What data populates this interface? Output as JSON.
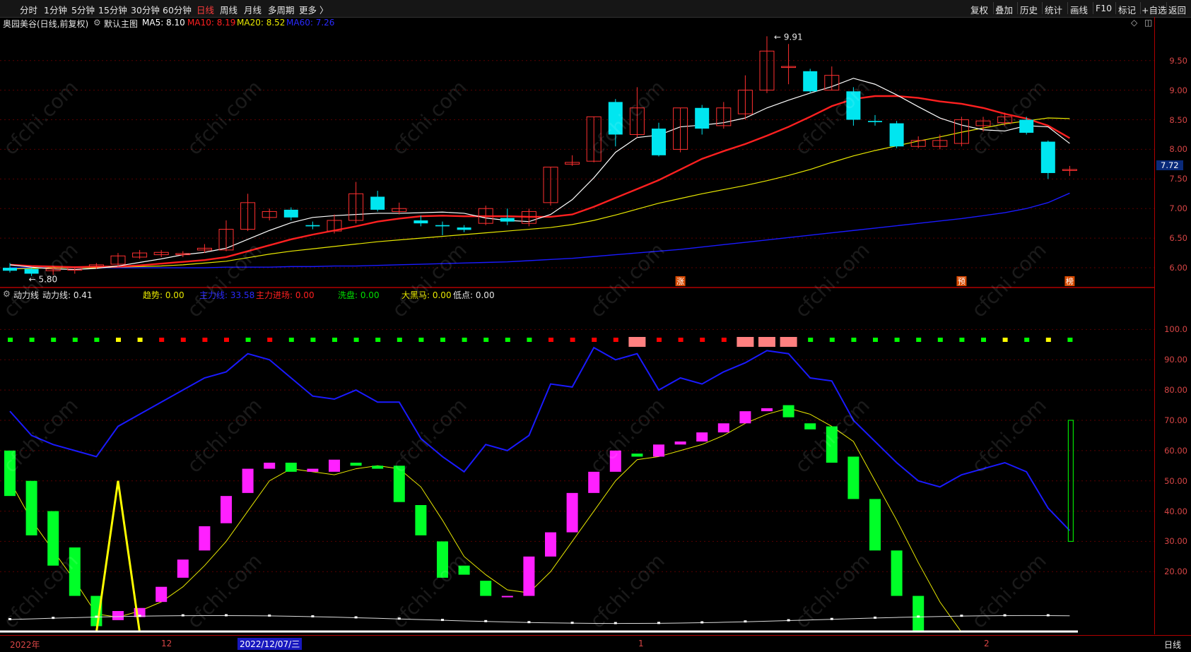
{
  "toolbar": {
    "periods": [
      "分时",
      "1分钟",
      "5分钟",
      "15分钟",
      "30分钟",
      "60分钟",
      "日线",
      "周线",
      "月线",
      "多周期",
      "更多 〉"
    ],
    "active": "日线",
    "right": [
      "复权",
      "叠加",
      "历史",
      "统计",
      "画线",
      "F10",
      "标记",
      "+自选",
      "返回"
    ]
  },
  "main_legend": {
    "title": "奥园美谷(日线,前复权)",
    "template": "默认主图",
    "ma5": "MA5: 8.10",
    "ma10": "MA10: 8.19",
    "ma20": "MA20: 8.52",
    "ma60": "MA60: 7.26",
    "colors": {
      "ma5": "#ffffff",
      "ma10": "#ff2020",
      "ma20": "#e8e800",
      "ma60": "#1a1aff"
    }
  },
  "sub_legend": {
    "name": "动力线",
    "power": "动力线: 0.41",
    "trend": "趋势: 0.00",
    "main_force": "主力线: 33.58",
    "inflow": "主力进场: 0.00",
    "wash": "洗盘: 0.00",
    "horse": "大黑马: 0.00",
    "low": "低点: 0.00"
  },
  "price_axis": [
    "9.50",
    "9.00",
    "8.50",
    "8.00",
    "7.50",
    "7.00",
    "6.50",
    "6.00"
  ],
  "price_current": "7.72",
  "sub_axis": [
    "100.0",
    "90.00",
    "80.00",
    "70.00",
    "60.00",
    "50.00",
    "40.00",
    "30.00",
    "20.00"
  ],
  "dates": {
    "d1": "2022年",
    "d2": "12",
    "cursor": "2022/12/07/三",
    "d3": "1",
    "d4": "2",
    "period_label": "日线"
  },
  "annotations": {
    "high": "9.91",
    "low": "5.80",
    "m1": "涨",
    "m2": "预",
    "m3": "榜"
  },
  "watermark": "cfchi.com",
  "chart_data": [
    {
      "type": "candlestick",
      "title": "奥园美谷(日线,前复权)",
      "ylim": [
        5.75,
        9.95
      ],
      "candles": [
        [
          6.0,
          5.95,
          6.08,
          5.92
        ],
        [
          5.98,
          5.9,
          6.0,
          5.86
        ],
        [
          5.95,
          5.98,
          6.02,
          5.88
        ],
        [
          5.96,
          6.0,
          6.02,
          5.9
        ],
        [
          6.02,
          6.05,
          6.08,
          5.98
        ],
        [
          6.06,
          6.2,
          6.25,
          6.02
        ],
        [
          6.18,
          6.25,
          6.3,
          6.15
        ],
        [
          6.22,
          6.26,
          6.3,
          6.18
        ],
        [
          6.22,
          6.24,
          6.28,
          6.18
        ],
        [
          6.3,
          6.33,
          6.4,
          6.25
        ],
        [
          6.3,
          6.65,
          6.8,
          6.28
        ],
        [
          6.65,
          7.1,
          7.25,
          6.62
        ],
        [
          6.85,
          6.95,
          7.0,
          6.8
        ],
        [
          6.98,
          6.85,
          7.02,
          6.8
        ],
        [
          6.72,
          6.7,
          6.78,
          6.65
        ],
        [
          6.62,
          6.8,
          6.9,
          6.58
        ],
        [
          6.8,
          7.25,
          7.45,
          6.75
        ],
        [
          7.2,
          6.98,
          7.3,
          6.95
        ],
        [
          6.95,
          7.0,
          7.1,
          6.9
        ],
        [
          6.8,
          6.75,
          6.88,
          6.7
        ],
        [
          6.72,
          6.7,
          6.78,
          6.55
        ],
        [
          6.68,
          6.64,
          6.72,
          6.6
        ],
        [
          6.75,
          7.0,
          7.05,
          6.72
        ],
        [
          6.84,
          6.78,
          7.0,
          6.72
        ],
        [
          6.75,
          6.95,
          7.0,
          6.7
        ],
        [
          7.1,
          7.7,
          7.7,
          7.05
        ],
        [
          7.75,
          7.78,
          7.9,
          7.72
        ],
        [
          7.8,
          8.55,
          8.55,
          7.78
        ],
        [
          8.8,
          8.25,
          8.85,
          8.05
        ],
        [
          8.25,
          8.7,
          9.05,
          8.2
        ],
        [
          8.35,
          7.9,
          8.45,
          7.88
        ],
        [
          8.0,
          8.7,
          8.7,
          7.95
        ],
        [
          8.7,
          8.35,
          8.75,
          8.25
        ],
        [
          8.4,
          8.7,
          8.8,
          8.35
        ],
        [
          8.6,
          9.0,
          9.25,
          8.5
        ],
        [
          9.0,
          9.66,
          9.91,
          8.95
        ],
        [
          9.4,
          9.4,
          9.78,
          9.1
        ],
        [
          9.32,
          8.98,
          9.36,
          8.95
        ],
        [
          9.0,
          9.25,
          9.4,
          9.0
        ],
        [
          8.98,
          8.5,
          9.05,
          8.4
        ],
        [
          8.48,
          8.46,
          8.58,
          8.4
        ],
        [
          8.44,
          8.05,
          8.48,
          8.02
        ],
        [
          8.05,
          8.15,
          8.22,
          8.02
        ],
        [
          8.05,
          8.15,
          8.25,
          8.0
        ],
        [
          8.1,
          8.5,
          8.55,
          8.05
        ],
        [
          8.4,
          8.48,
          8.55,
          8.3
        ],
        [
          8.45,
          8.55,
          8.62,
          8.4
        ],
        [
          8.5,
          8.28,
          8.55,
          8.25
        ],
        [
          8.13,
          7.6,
          8.15,
          7.5
        ],
        [
          7.65,
          7.66,
          7.72,
          7.55
        ]
      ],
      "ma5": [
        6.05,
        6.01,
        5.98,
        5.97,
        5.99,
        6.03,
        6.09,
        6.15,
        6.22,
        6.26,
        6.33,
        6.48,
        6.63,
        6.76,
        6.85,
        6.88,
        6.9,
        6.92,
        6.92,
        6.93,
        6.94,
        6.92,
        6.84,
        6.8,
        6.78,
        6.9,
        7.15,
        7.52,
        7.95,
        8.2,
        8.24,
        8.38,
        8.41,
        8.45,
        8.53,
        8.7,
        8.83,
        8.95,
        9.06,
        9.2,
        9.1,
        8.92,
        8.72,
        8.53,
        8.41,
        8.33,
        8.31,
        8.4,
        8.38,
        8.1
      ],
      "ma10": [
        6.05,
        6.03,
        6.02,
        6.01,
        6.02,
        6.02,
        6.04,
        6.07,
        6.1,
        6.13,
        6.18,
        6.28,
        6.38,
        6.48,
        6.56,
        6.63,
        6.7,
        6.78,
        6.83,
        6.87,
        6.88,
        6.87,
        6.87,
        6.87,
        6.86,
        6.86,
        6.9,
        7.03,
        7.18,
        7.33,
        7.48,
        7.66,
        7.84,
        7.97,
        8.09,
        8.23,
        8.38,
        8.55,
        8.73,
        8.85,
        8.9,
        8.9,
        8.87,
        8.81,
        8.77,
        8.7,
        8.6,
        8.52,
        8.4,
        8.19
      ],
      "ma20": [
        5.98,
        5.99,
        6.0,
        6.0,
        6.0,
        6.01,
        6.02,
        6.03,
        6.05,
        6.08,
        6.11,
        6.17,
        6.23,
        6.28,
        6.32,
        6.36,
        6.4,
        6.44,
        6.47,
        6.5,
        6.53,
        6.56,
        6.59,
        6.62,
        6.65,
        6.68,
        6.73,
        6.8,
        6.89,
        6.99,
        7.09,
        7.17,
        7.25,
        7.32,
        7.39,
        7.47,
        7.56,
        7.66,
        7.78,
        7.89,
        7.98,
        8.06,
        8.14,
        8.21,
        8.29,
        8.36,
        8.43,
        8.48,
        8.53,
        8.52
      ],
      "ma60": [
        6.0,
        6.0,
        6.0,
        6.0,
        6.0,
        6.0,
        6.0,
        6.0,
        6.0,
        6.0,
        6.01,
        6.01,
        6.01,
        6.02,
        6.02,
        6.03,
        6.03,
        6.04,
        6.05,
        6.06,
        6.07,
        6.08,
        6.09,
        6.1,
        6.12,
        6.14,
        6.16,
        6.19,
        6.22,
        6.25,
        6.28,
        6.31,
        6.35,
        6.39,
        6.43,
        6.47,
        6.51,
        6.55,
        6.59,
        6.63,
        6.67,
        6.71,
        6.75,
        6.79,
        6.83,
        6.88,
        6.93,
        7.0,
        7.1,
        7.26
      ]
    },
    {
      "type": "bar",
      "title": "动力线",
      "ylim": [
        0,
        105
      ],
      "power_line": [
        50,
        37,
        27,
        17,
        6,
        5,
        7,
        10,
        15,
        22,
        30,
        40,
        50,
        54,
        53,
        52,
        54,
        55,
        54,
        48,
        37,
        25,
        19,
        14,
        13,
        20,
        30,
        40,
        50,
        57,
        58,
        60,
        62,
        65,
        69,
        72,
        74,
        72,
        68,
        63,
        50,
        37,
        23,
        10,
        0,
        0,
        0,
        0,
        0,
        0
      ],
      "bars": [
        [
          60,
          45,
          1
        ],
        [
          50,
          32,
          1
        ],
        [
          40,
          22,
          1
        ],
        [
          28,
          12,
          1
        ],
        [
          12,
          2,
          1
        ],
        [
          4,
          7,
          0
        ],
        [
          5,
          8,
          0
        ],
        [
          10,
          15,
          0
        ],
        [
          18,
          24,
          0
        ],
        [
          27,
          35,
          0
        ],
        [
          36,
          45,
          0
        ],
        [
          46,
          54,
          0
        ],
        [
          54,
          56,
          0
        ],
        [
          56,
          53,
          1
        ],
        [
          54,
          53,
          0
        ],
        [
          53,
          57,
          0
        ],
        [
          56,
          55,
          1
        ],
        [
          55,
          54,
          1
        ],
        [
          55,
          43,
          1
        ],
        [
          42,
          32,
          1
        ],
        [
          30,
          18,
          1
        ],
        [
          22,
          19,
          1
        ],
        [
          17,
          12,
          1
        ],
        [
          12,
          12,
          0
        ],
        [
          12,
          25,
          0
        ],
        [
          25,
          33,
          0
        ],
        [
          33,
          46,
          0
        ],
        [
          46,
          53,
          0
        ],
        [
          53,
          60,
          0
        ],
        [
          59,
          58,
          1
        ],
        [
          58,
          62,
          0
        ],
        [
          62,
          63,
          0
        ],
        [
          63,
          66,
          0
        ],
        [
          66,
          69,
          0
        ],
        [
          69,
          73,
          0
        ],
        [
          73,
          74,
          0
        ],
        [
          75,
          71,
          1
        ],
        [
          69,
          67,
          1
        ],
        [
          68,
          56,
          1
        ],
        [
          58,
          44,
          1
        ],
        [
          44,
          27,
          1
        ],
        [
          27,
          12,
          1
        ],
        [
          12,
          0,
          1
        ]
      ],
      "main_force": [
        73,
        65,
        62,
        60,
        58,
        68,
        72,
        76,
        80,
        84,
        86,
        92,
        90,
        84,
        78,
        77,
        80,
        76,
        76,
        64,
        58,
        53,
        62,
        60,
        65,
        82,
        81,
        94,
        90,
        92,
        80,
        84,
        82,
        86,
        89,
        93,
        92,
        84,
        83,
        70,
        63,
        56,
        50,
        48,
        52,
        54,
        56,
        53,
        41,
        33.58
      ],
      "trend_spike": [
        0,
        50,
        0
      ],
      "top_squares": [
        "#0f0",
        "#0f0",
        "#0f0",
        "#0f0",
        "#0f0",
        "#ff0",
        "#ff0",
        "#f00",
        "#f00",
        "#f00",
        "#f00",
        "#0f0",
        "#f00",
        "#0f0",
        "#0f0",
        "#0f0",
        "#0f0",
        "#0f0",
        "#0f0",
        "#0f0",
        "#0f0",
        "#0f0",
        "#0f0",
        "#0f0",
        "#0f0",
        "#f00",
        "#f00",
        "#f00",
        "#f00",
        "#f66",
        "#f00",
        "#f00",
        "#f00",
        "#f00",
        "#f66",
        "#f66",
        "#f66",
        "#0f0",
        "#0f0",
        "#0f0",
        "#0f0",
        "#0f0",
        "#0f0",
        "#0f0",
        "#0f0",
        "#0f0",
        "#ff0",
        "#0f0",
        "#ff0",
        "#0f0"
      ],
      "hollow_bar": [
        30,
        70
      ]
    }
  ]
}
